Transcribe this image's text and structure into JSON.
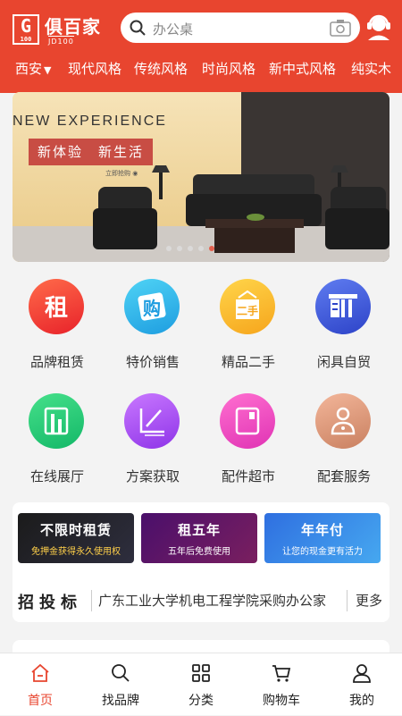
{
  "header": {
    "logo": {
      "box_text": "G",
      "box_sub": "100",
      "name": "俱百家",
      "sub": "JD100"
    },
    "search": {
      "placeholder": "办公桌"
    },
    "colors": {
      "brand": "#e8452f"
    }
  },
  "categories": {
    "city": "西安",
    "items": [
      "现代风格",
      "传统风格",
      "时尚风格",
      "新中式风格",
      "纯实木"
    ]
  },
  "banner": {
    "title": "NEW EXPERIENCE",
    "subtitle": "新体验　新生活",
    "small_text": "立即抢购 ◉",
    "slides": 5,
    "active_slide": 5
  },
  "grid": [
    {
      "label": "品牌租赁",
      "icon": "rent-icon"
    },
    {
      "label": "特价销售",
      "icon": "sale-icon"
    },
    {
      "label": "精品二手",
      "icon": "second-hand-icon"
    },
    {
      "label": "闲具自贸",
      "icon": "idle-furniture-icon"
    },
    {
      "label": "在线展厅",
      "icon": "showroom-icon"
    },
    {
      "label": "方案获取",
      "icon": "plan-icon"
    },
    {
      "label": "配件超市",
      "icon": "parts-icon"
    },
    {
      "label": "配套服务",
      "icon": "service-icon"
    }
  ],
  "promos": [
    {
      "title": "不限时租赁",
      "subtitle": "免押金获得永久使用权"
    },
    {
      "title": "租五年",
      "subtitle": "五年后免费使用"
    },
    {
      "title": "年年付",
      "subtitle": "让您的现金更有活力"
    }
  ],
  "notice": {
    "label": "招投标",
    "text": "广东工业大学机电工程学院采购办公家",
    "more": "更多"
  },
  "tabbar": [
    {
      "label": "首页",
      "icon": "home-icon",
      "active": true
    },
    {
      "label": "找品牌",
      "icon": "search-icon",
      "active": false
    },
    {
      "label": "分类",
      "icon": "category-icon",
      "active": false
    },
    {
      "label": "购物车",
      "icon": "cart-icon",
      "active": false
    },
    {
      "label": "我的",
      "icon": "profile-icon",
      "active": false
    }
  ]
}
